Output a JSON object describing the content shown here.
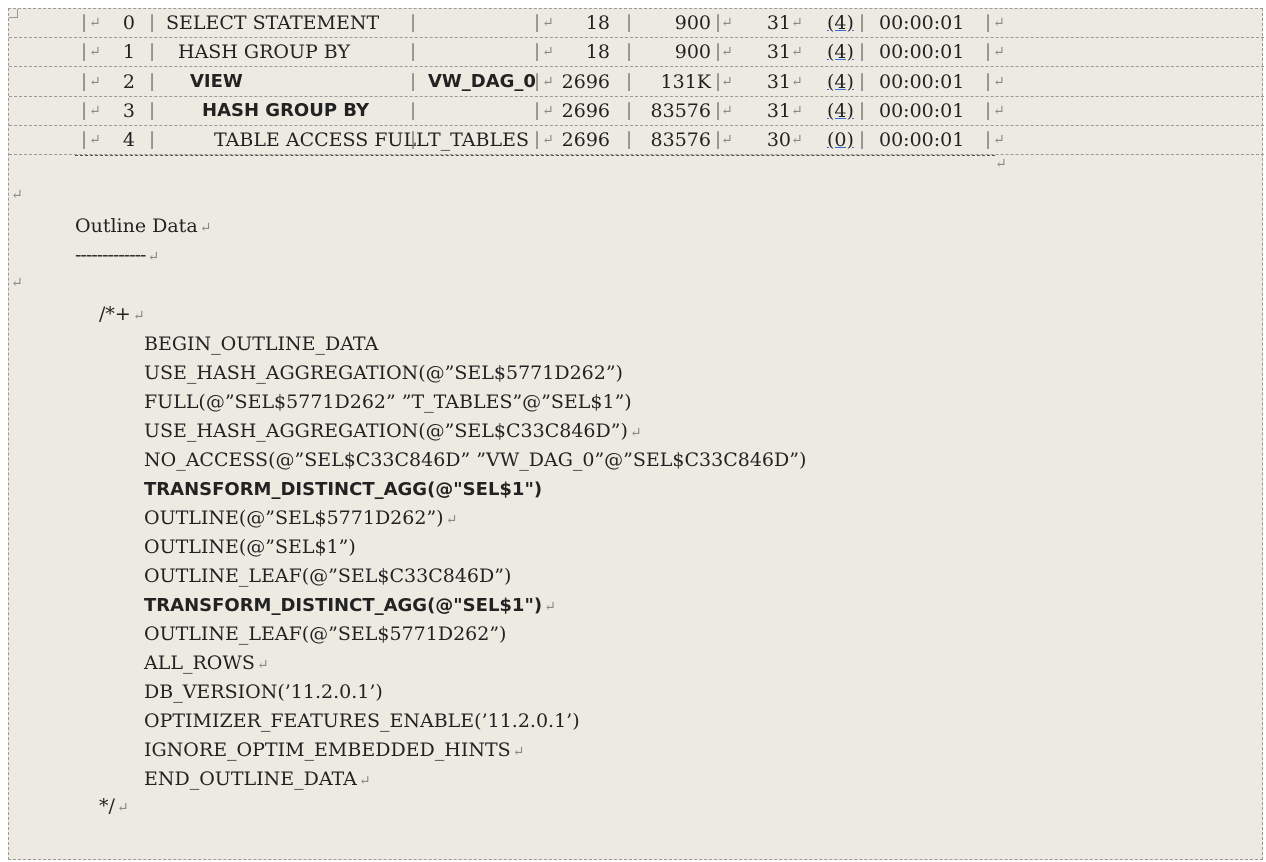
{
  "plan_rows": [
    {
      "id": "0",
      "operation": "SELECT STATEMENT",
      "name": "",
      "rows": "18",
      "bytes": "900",
      "cost": "31",
      "cpu": "(4)",
      "time": "00:00:01",
      "bold": false
    },
    {
      "id": "1",
      "operation": "HASH GROUP BY",
      "name": "",
      "rows": "18",
      "bytes": "900",
      "cost": "31",
      "cpu": "(4)",
      "time": "00:00:01",
      "bold": false
    },
    {
      "id": "2",
      "operation": "VIEW",
      "name": "VW_DAG_0",
      "rows": "2696",
      "bytes": "131K",
      "cost": "31",
      "cpu": "(4)",
      "time": "00:00:01",
      "bold": true
    },
    {
      "id": "3",
      "operation": "HASH GROUP BY",
      "name": "",
      "rows": "2696",
      "bytes": "83576",
      "cost": "31",
      "cpu": "(4)",
      "time": "00:00:01",
      "bold": true
    },
    {
      "id": "4",
      "operation": "TABLE ACCESS FULL",
      "name": "T_TABLES",
      "rows": "2696",
      "bytes": "83576",
      "cost": "30",
      "cpu": "(0)",
      "time": "00:00:01",
      "bold": false
    }
  ],
  "separator": "|",
  "outline": {
    "heading": "Outline Data",
    "underline": "-------------",
    "open": "/*+",
    "close": "*/",
    "hints": [
      {
        "text": "BEGIN_OUTLINE_DATA",
        "bold": false,
        "mark": false
      },
      {
        "text": "USE_HASH_AGGREGATION(@”SEL$5771D262”)",
        "bold": false,
        "mark": false
      },
      {
        "text": "FULL(@”SEL$5771D262” ”T_TABLES”@”SEL$1”)",
        "bold": false,
        "mark": false
      },
      {
        "text": "USE_HASH_AGGREGATION(@”SEL$C33C846D”)",
        "bold": false,
        "mark": true
      },
      {
        "text": "NO_ACCESS(@”SEL$C33C846D” ”VW_DAG_0”@”SEL$C33C846D”)",
        "bold": false,
        "mark": false
      },
      {
        "text": "TRANSFORM_DISTINCT_AGG(@\"SEL$1\")",
        "bold": true,
        "mark": false
      },
      {
        "text": "OUTLINE(@”SEL$5771D262”)",
        "bold": false,
        "mark": true
      },
      {
        "text": "OUTLINE(@”SEL$1”)",
        "bold": false,
        "mark": false
      },
      {
        "text": "OUTLINE_LEAF(@”SEL$C33C846D”)",
        "bold": false,
        "mark": false
      },
      {
        "text": "TRANSFORM_DISTINCT_AGG(@\"SEL$1\")",
        "bold": true,
        "mark": true
      },
      {
        "text": "OUTLINE_LEAF(@”SEL$5771D262”)",
        "bold": false,
        "mark": false
      },
      {
        "text": "ALL_ROWS",
        "bold": false,
        "mark": true
      },
      {
        "text": "DB_VERSION(’11.2.0.1’)",
        "bold": false,
        "mark": false
      },
      {
        "text": "OPTIMIZER_FEATURES_ENABLE(’11.2.0.1’)",
        "bold": false,
        "mark": false
      },
      {
        "text": "IGNORE_OPTIM_EMBEDDED_HINTS",
        "bold": false,
        "mark": true
      },
      {
        "text": "END_OUTLINE_DATA",
        "bold": false,
        "mark": true
      }
    ]
  },
  "para_mark": "↵"
}
